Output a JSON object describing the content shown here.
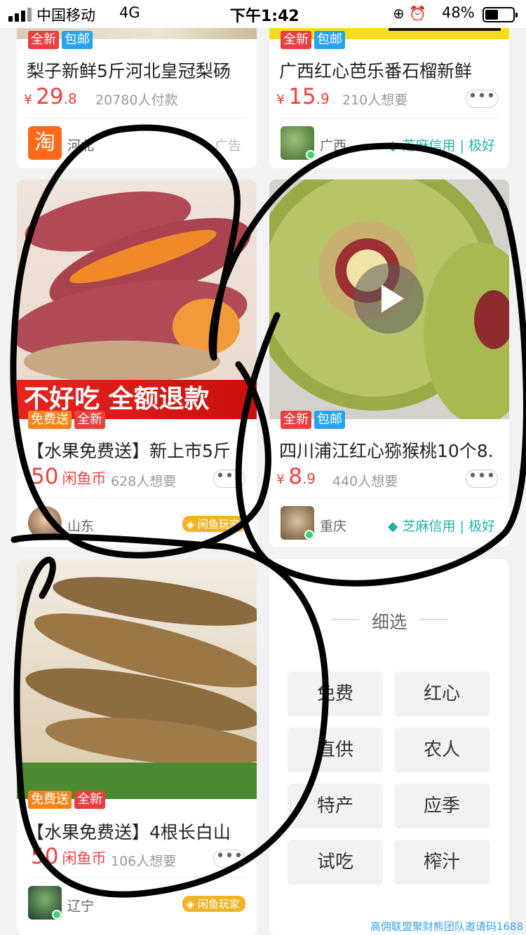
{
  "status_bar": {
    "carrier": "中国移动",
    "network": "4G",
    "time": "下午1:42",
    "battery": "48%",
    "battery_level": 0.48
  },
  "cards": {
    "pear": {
      "tag1": "全新",
      "tag2": "包邮",
      "title": "梨子新鲜5斤河北皇冠梨砀",
      "price_currency": "¥",
      "price_int": "29",
      "price_dec": ".8",
      "count": "20780人付款",
      "location": "河北",
      "shop_icon": "淘",
      "ad_label": "广告"
    },
    "guava": {
      "tag1": "全新",
      "tag2": "包邮",
      "title": "广西红心芭乐番石榴新鲜",
      "price_currency": "¥",
      "price_int": "15",
      "price_dec": ".9",
      "count": "210人想要",
      "location": "广西",
      "credit": "芝麻信用 | 极好"
    },
    "sweet_potato": {
      "banner": "不好吃 全额退款",
      "tag1": "免费送",
      "tag2": "全新",
      "title": "【水果免费送】新上市5斤",
      "price_int": "50",
      "price_unit": "闲鱼币",
      "count": "628人想要",
      "location": "山东",
      "badge": "闲鱼玩家"
    },
    "kiwi": {
      "tag1": "全新",
      "tag2": "包邮",
      "title": "四川浦江红心猕猴桃10个8.",
      "price_currency": "¥",
      "price_int": "8",
      "price_dec": ".9",
      "count": "440人想要",
      "location": "重庆",
      "credit": "芝麻信用 | 极好"
    },
    "ginseng": {
      "tag1": "免费送",
      "tag2": "全新",
      "title": "【水果免费送】4根长白山",
      "price_int": "50",
      "price_unit": "闲鱼币",
      "count": "106人想要",
      "location": "辽宁",
      "badge": "闲鱼玩家"
    }
  },
  "filter": {
    "title": "细选",
    "chips": [
      "免费",
      "红心",
      "直供",
      "农人",
      "特产",
      "应季",
      "试吃",
      "榨汁"
    ]
  },
  "watermark": "高佣联盟聚财熊团队邀请码1688"
}
